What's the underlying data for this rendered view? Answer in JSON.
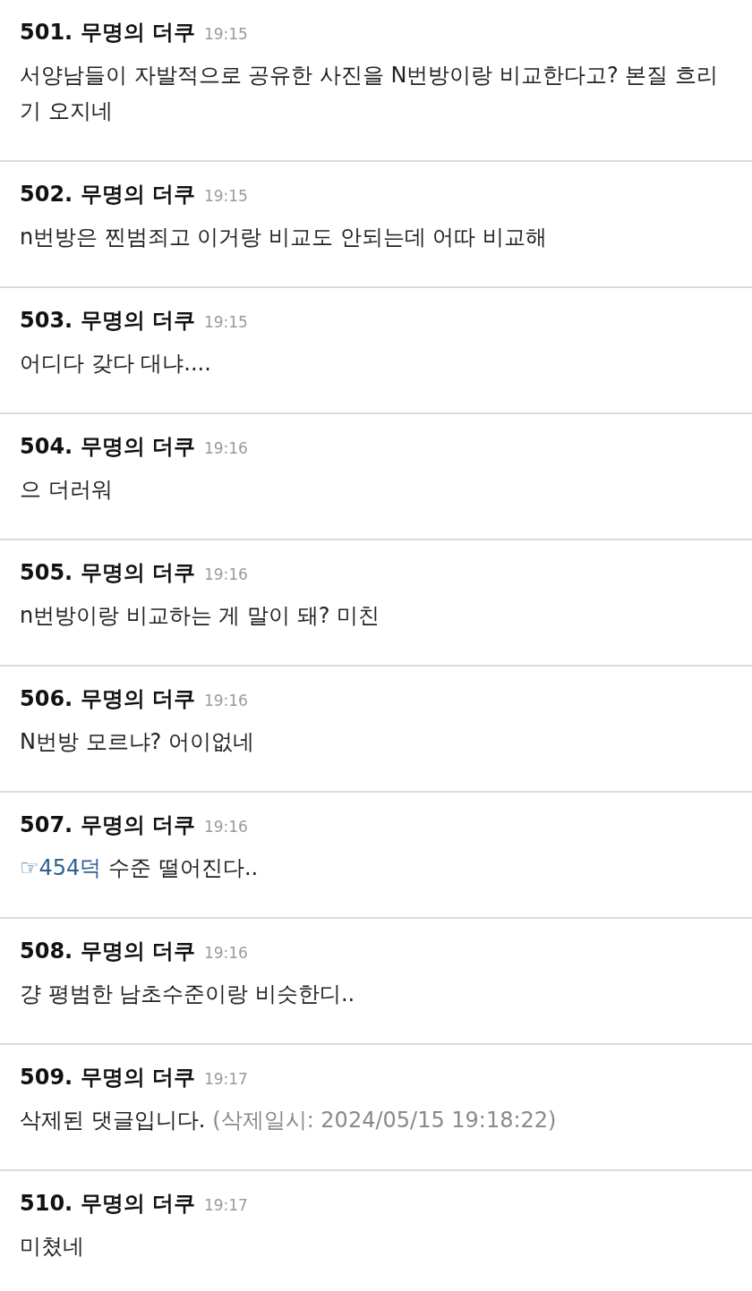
{
  "comments": [
    {
      "number": "501.",
      "author": "무명의 더쿠",
      "time": "19:15",
      "body": "서양남들이 자발적으로 공유한 사진을 N번방이랑 비교한다고? 본질 흐리기 오지네"
    },
    {
      "number": "502.",
      "author": "무명의 더쿠",
      "time": "19:15",
      "body": "n번방은 찐범죄고 이거랑 비교도 안되는데 어따 비교해"
    },
    {
      "number": "503.",
      "author": "무명의 더쿠",
      "time": "19:15",
      "body": "어디다 갖다 대냐...."
    },
    {
      "number": "504.",
      "author": "무명의 더쿠",
      "time": "19:16",
      "body": "으 더러워"
    },
    {
      "number": "505.",
      "author": "무명의 더쿠",
      "time": "19:16",
      "body": "n번방이랑 비교하는 게 말이 돼? 미친"
    },
    {
      "number": "506.",
      "author": "무명의 더쿠",
      "time": "19:16",
      "body": "N번방 모르냐? 어이없네"
    },
    {
      "number": "507.",
      "author": "무명의 더쿠",
      "time": "19:16",
      "reply_link": "☞454덕",
      "body": "수준 떨어진다.."
    },
    {
      "number": "508.",
      "author": "무명의 더쿠",
      "time": "19:16",
      "body": "걍 평범한 남초수준이랑 비슷한디.."
    },
    {
      "number": "509.",
      "author": "무명의 더쿠",
      "time": "19:17",
      "body": "삭제된 댓글입니다.",
      "deleted_note": "(삭제일시: 2024/05/15 19:18:22)"
    },
    {
      "number": "510.",
      "author": "무명의 더쿠",
      "time": "19:17",
      "body": "미쳤네"
    }
  ]
}
